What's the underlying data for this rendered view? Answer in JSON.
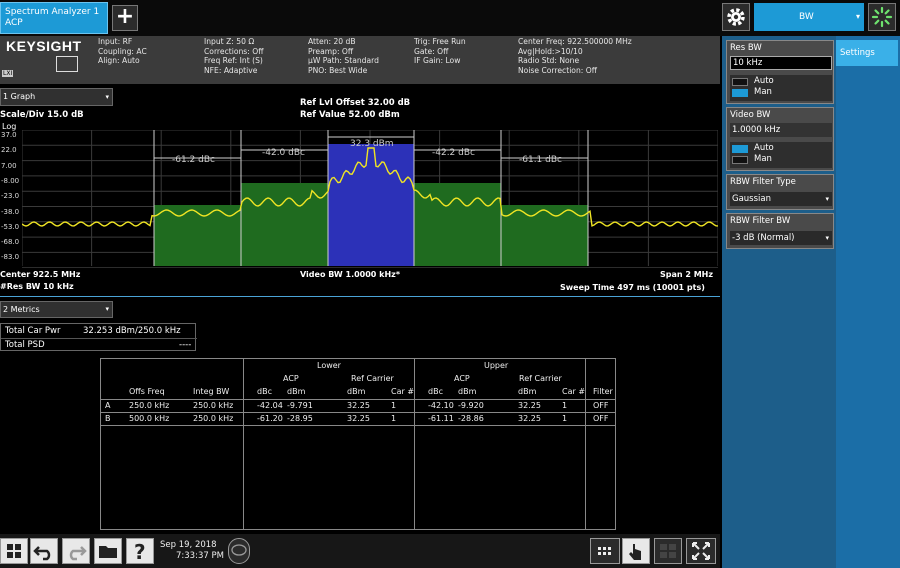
{
  "tab": {
    "line1": "Spectrum Analyzer 1",
    "line2": "ACP"
  },
  "menu": {
    "selected": "BW"
  },
  "logo": {
    "brand": "KEYSIGHT",
    "badge": "LXI"
  },
  "header": {
    "col1": [
      "Input: RF",
      "Coupling: AC",
      "Align: Auto"
    ],
    "col2": [
      "Input Z: 50 Ω",
      "Corrections: Off",
      "Freq Ref: Int (S)",
      "NFE: Adaptive"
    ],
    "col3": [
      "Atten: 20 dB",
      "Preamp: Off",
      "µW Path: Standard",
      "PNO: Best Wide"
    ],
    "col4": [
      "Trig: Free Run",
      "Gate: Off",
      "IF Gain: Low"
    ],
    "col5": [
      "Center Freq: 922.500000 MHz",
      "Avg|Hold:>10/10",
      "Radio Std: None",
      "Noise Correction: Off"
    ]
  },
  "graph": {
    "selector": "1 Graph",
    "ref_offset": "Ref Lvl Offset 32.00 dB",
    "ref_value": "Ref Value 52.00 dBm",
    "scale": "Scale/Div 15.0 dB",
    "log": "Log",
    "yticks": [
      "37.0",
      "22.0",
      "7.00",
      "-8.00",
      "-23.0",
      "-38.0",
      "-53.0",
      "-68.0",
      "-83.0"
    ],
    "center": "Center 922.5 MHz",
    "res_bw": "#Res BW 10 kHz",
    "video_bw": "Video BW 1.0000 kHz*",
    "span": "Span 2 MHz",
    "sweep": "Sweep Time 497 ms (10001 pts)",
    "annotations": {
      "carrier": "32.3 dBm",
      "lower_a": "-42.0 dBc",
      "lower_b": "-61.2 dBc",
      "upper_a": "-42.2 dBc",
      "upper_b": "-61.1 dBc"
    },
    "colors": {
      "trace": "#f0e524",
      "carrier": "#2c31b8",
      "adjacent": "#1f6b1f",
      "grid": "#3a3a3a"
    }
  },
  "metrics": {
    "selector": "2 Metrics",
    "total_car_pwr_label": "Total Car Pwr",
    "total_car_pwr_value": "32.253 dBm/250.0 kHz",
    "total_psd_label": "Total PSD",
    "total_psd_value": "----"
  },
  "acp_table": {
    "group_lower": "Lower",
    "group_upper": "Upper",
    "sub_acp": "ACP",
    "sub_ref": "Ref Carrier",
    "headers": [
      "",
      "Offs Freq",
      "Integ BW",
      "dBc",
      "dBm",
      "dBm",
      "Car #",
      "dBc",
      "dBm",
      "dBm",
      "Car #",
      "Filter"
    ],
    "rows": [
      [
        "A",
        "250.0 kHz",
        "250.0 kHz",
        "-42.04",
        "-9.791",
        "32.25",
        "1",
        "-42.10",
        "-9.920",
        "32.25",
        "1",
        "OFF"
      ],
      [
        "B",
        "500.0 kHz",
        "250.0 kHz",
        "-61.20",
        "-28.95",
        "32.25",
        "1",
        "-61.11",
        "-28.86",
        "32.25",
        "1",
        "OFF"
      ]
    ]
  },
  "statusbar": {
    "date": "Sep 19, 2018",
    "time": "7:33:37 PM"
  },
  "panel": {
    "tab": "Settings",
    "res_bw": {
      "title": "Res BW",
      "value": "10 kHz",
      "auto": "Auto",
      "man": "Man"
    },
    "video_bw": {
      "title": "Video BW",
      "value": "1.0000 kHz",
      "auto": "Auto",
      "man": "Man"
    },
    "rbw_filter_type": {
      "title": "RBW Filter Type",
      "value": "Gaussian"
    },
    "rbw_filter_bw": {
      "title": "RBW Filter BW",
      "value": "-3 dB (Normal)"
    }
  }
}
